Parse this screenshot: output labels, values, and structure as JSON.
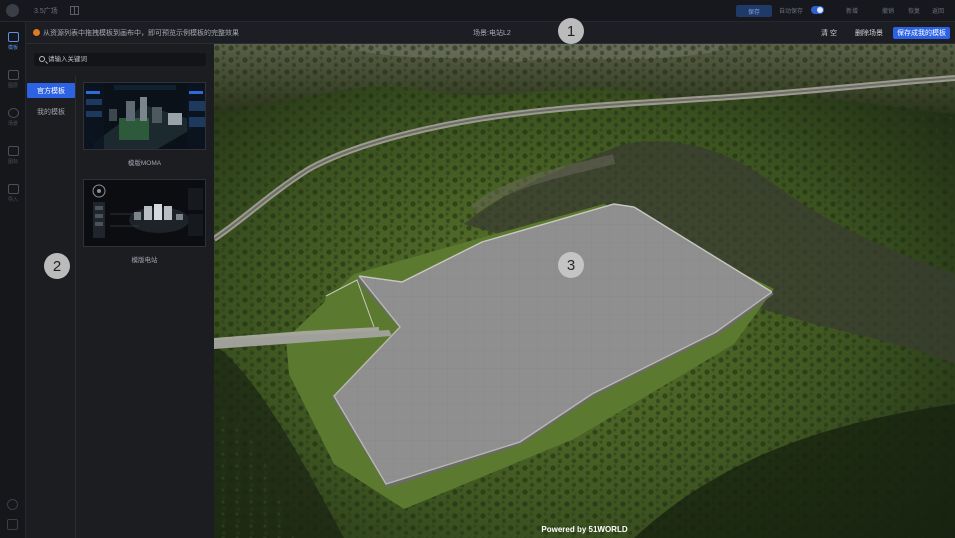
{
  "topbar": {
    "app_title": "3.5广场",
    "save_label": "保存",
    "autosave_label": "自动保存",
    "items": [
      "新增",
      "撤销",
      "恢复",
      "返回"
    ]
  },
  "rail": {
    "items": [
      {
        "label": "模板",
        "icon": "folder-icon",
        "active": true
      },
      {
        "label": "图层",
        "icon": "layers-icon",
        "active": false
      },
      {
        "label": "场景",
        "icon": "cube-icon",
        "active": false
      },
      {
        "label": "图标",
        "icon": "grid-icon",
        "active": false
      },
      {
        "label": "导入",
        "icon": "import-icon",
        "active": false
      }
    ]
  },
  "notice": {
    "message": "从资源列表中拖拽模板到画布中，即可预览示例模板的完整效果",
    "scene_label": "场景:电站L2",
    "clear_label": "清 空",
    "delete_scene_label": "删除场景",
    "save_as_label": "保存成我的模板"
  },
  "panel": {
    "search_placeholder": "请输入关键词",
    "categories": [
      {
        "label": "官方模板",
        "active": true
      },
      {
        "label": "我的模板",
        "active": false
      }
    ],
    "templates": [
      {
        "caption": "模版MOMA"
      },
      {
        "caption": "模版电站"
      }
    ],
    "collapse_glyph": "«"
  },
  "viewport": {
    "powered_by": "Powered by 51WORLD"
  },
  "markers": [
    "1",
    "2",
    "3"
  ],
  "colors": {
    "accent": "#2d63e2",
    "warning": "#e07b1e",
    "panel_bg": "#1b1d21",
    "site_surface": "#8e8e8e"
  }
}
